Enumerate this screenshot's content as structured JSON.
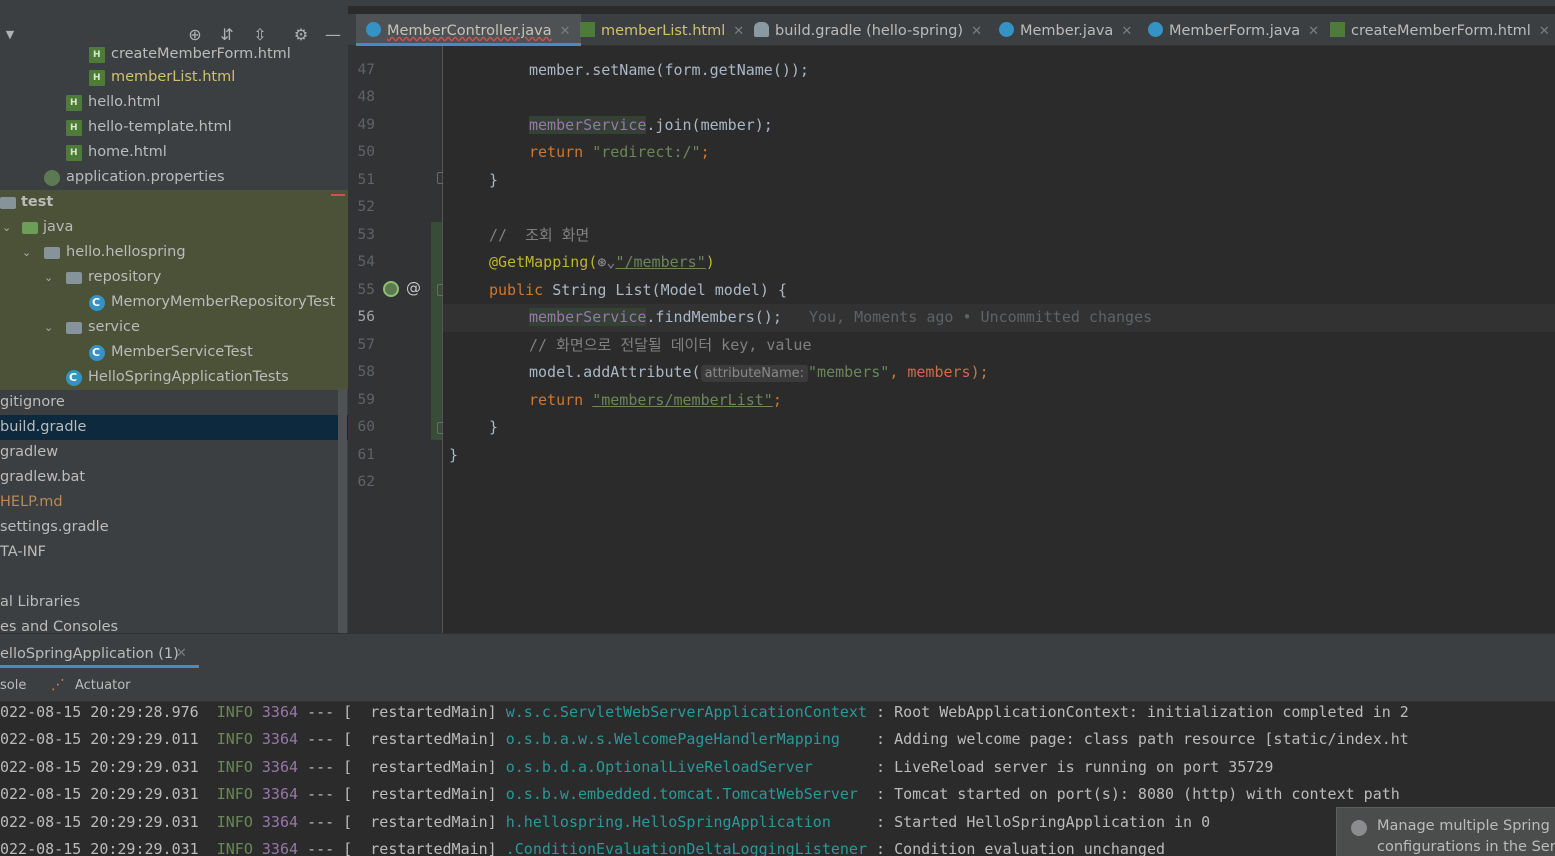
{
  "project_tree": {
    "items": [
      {
        "label": "createMemberForm.html",
        "icon": "html-file-icon"
      },
      {
        "label": "memberList.html",
        "icon": "html-file-icon"
      },
      {
        "label": "hello.html",
        "icon": "html-file-icon"
      },
      {
        "label": "hello-template.html",
        "icon": "html-file-icon"
      },
      {
        "label": "home.html",
        "icon": "html-file-icon"
      },
      {
        "label": "application.properties",
        "icon": "gear-icon"
      },
      {
        "label": "test",
        "icon": "folder-icon"
      },
      {
        "label": "java",
        "icon": "folder-icon"
      },
      {
        "label": "hello.hellospring",
        "icon": "package-icon"
      },
      {
        "label": "repository",
        "icon": "package-icon"
      },
      {
        "label": "MemoryMemberRepositoryTest",
        "icon": "class-icon"
      },
      {
        "label": "service",
        "icon": "package-icon"
      },
      {
        "label": "MemberServiceTest",
        "icon": "class-icon"
      },
      {
        "label": "HelloSpringApplicationTests",
        "icon": "class-icon"
      },
      {
        "label": "gitignore",
        "icon": "file-icon"
      },
      {
        "label": "build.gradle",
        "icon": "gradle-file-icon"
      },
      {
        "label": "gradlew",
        "icon": "file-icon"
      },
      {
        "label": "gradlew.bat",
        "icon": "file-icon"
      },
      {
        "label": "HELP.md",
        "icon": "markdown-file-icon"
      },
      {
        "label": "settings.gradle",
        "icon": "gradle-file-icon"
      },
      {
        "label": "TA-INF",
        "icon": "folder-icon"
      },
      {
        "label": "al Libraries",
        "icon": "library-icon"
      },
      {
        "label": "es and Consoles",
        "icon": "console-icon"
      }
    ]
  },
  "editor_tabs": [
    {
      "label": "MemberController.java",
      "icon": "class-icon",
      "active": true
    },
    {
      "label": "memberList.html",
      "icon": "html-file-icon",
      "active": false
    },
    {
      "label": "build.gradle (hello-spring)",
      "icon": "gradle-file-icon",
      "active": false
    },
    {
      "label": "Member.java",
      "icon": "class-icon",
      "active": false
    },
    {
      "label": "MemberForm.java",
      "icon": "class-icon",
      "active": false
    },
    {
      "label": "createMemberForm.html",
      "icon": "html-file-icon",
      "active": false
    }
  ],
  "line_numbers": [
    "47",
    "48",
    "49",
    "50",
    "51",
    "52",
    "53",
    "54",
    "55",
    "56",
    "57",
    "58",
    "59",
    "60",
    "61",
    "62"
  ],
  "code": {
    "line47_a": "member.setName(form.getName());",
    "line49_field": "memberService",
    "line49_rest": ".join(member);",
    "line50_kw": "return",
    "line50_str": "\"redirect:/\"",
    "line50_semi": ";",
    "line51": "}",
    "line53": "//  조회 화면",
    "line54_ann": "@GetMapping(",
    "line54_str": "\"/members\"",
    "line54_close": ")",
    "line55_kw": "public",
    "line55_rest": " String List(Model model) {",
    "line56_field": "memberService",
    "line56_rest": ".findMembers();",
    "line56_blame": "You, Moments ago • Uncommitted changes",
    "line57": "// 화면으로 전달될 데이터 key, value",
    "line58_a": "model.addAttribute(",
    "line58_hint": "attributeName:",
    "line58_str": "\"members\"",
    "line58_comma": ", ",
    "line58_var": "members",
    "line58_end": ");",
    "line59_kw": "return",
    "line59_str": "\"members/memberList\"",
    "line59_semi": ";",
    "line60": "}",
    "line61": "}"
  },
  "run_tab": {
    "label": "elloSpringApplication (1)"
  },
  "console_tabs": [
    {
      "label": "sole"
    },
    {
      "label": "Actuator",
      "icon": "actuator-icon"
    }
  ],
  "console_lines": [
    {
      "time": "022-08-15 20:29:28.976",
      "level": "INFO",
      "pid": "3364",
      "sep": "--- [  restartedMain]",
      "logger": "w.s.c.ServletWebServerApplicationContext",
      "msg": ": Root WebApplicationContext: initialization completed in 2"
    },
    {
      "time": "022-08-15 20:29:29.011",
      "level": "INFO",
      "pid": "3364",
      "sep": "--- [  restartedMain]",
      "logger": "o.s.b.a.w.s.WelcomePageHandlerMapping",
      "msg": ": Adding welcome page: class path resource [static/index.ht"
    },
    {
      "time": "022-08-15 20:29:29.031",
      "level": "INFO",
      "pid": "3364",
      "sep": "--- [  restartedMain]",
      "logger": "o.s.b.d.a.OptionalLiveReloadServer",
      "msg": ": LiveReload server is running on port 35729"
    },
    {
      "time": "022-08-15 20:29:29.031",
      "level": "INFO",
      "pid": "3364",
      "sep": "--- [  restartedMain]",
      "logger": "o.s.b.w.embedded.tomcat.TomcatWebServer",
      "msg": ": Tomcat started on port(s): 8080 (http) with context path"
    },
    {
      "time": "022-08-15 20:29:29.031",
      "level": "INFO",
      "pid": "3364",
      "sep": "--- [  restartedMain]",
      "logger": "h.hellospring.HelloSpringApplication",
      "msg": ": Started HelloSpringApplication in 0"
    },
    {
      "time": "022-08-15 20:29:29.031",
      "level": "INFO",
      "pid": "3364",
      "sep": "--- [  restartedMain]",
      "logger": ".ConditionEvaluationDeltaLoggingListener",
      "msg": ": Condition evaluation unchanged"
    }
  ],
  "notification": {
    "line1": "Manage multiple Spring B",
    "line2": "configurations in the Servi"
  },
  "colors": {
    "background": "#2b2b2b",
    "panel": "#3c3f41",
    "accent": "#4a88c7",
    "keyword": "#cc7832",
    "string": "#6a8759"
  }
}
